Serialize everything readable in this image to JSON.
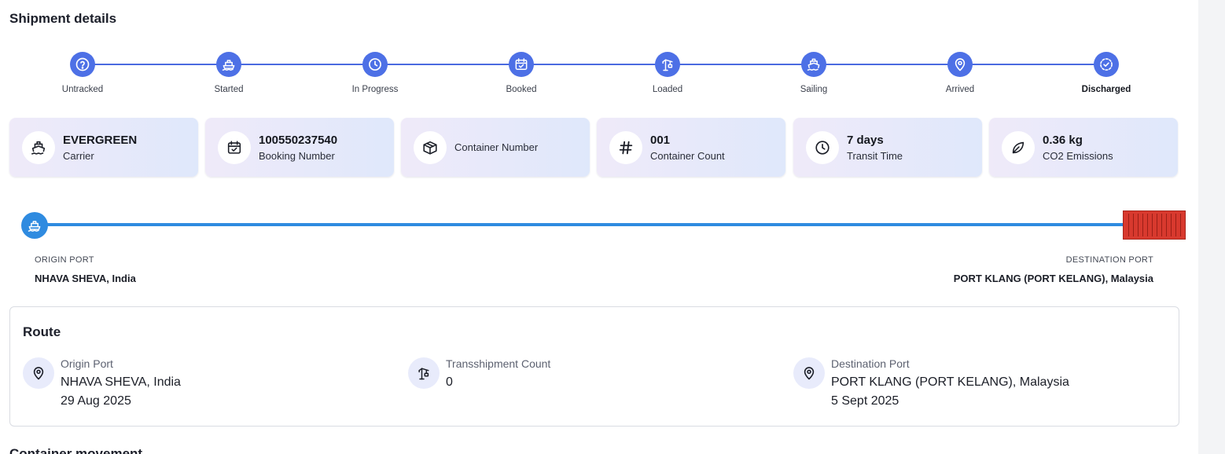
{
  "page": {
    "title": "Shipment details",
    "next_section_title": "Container movement"
  },
  "stepper": {
    "steps": [
      {
        "label": "Untracked",
        "icon": "help-circle-icon"
      },
      {
        "label": "Started",
        "icon": "ship-icon"
      },
      {
        "label": "In Progress",
        "icon": "clock-icon"
      },
      {
        "label": "Booked",
        "icon": "calendar-check-icon"
      },
      {
        "label": "Loaded",
        "icon": "crane-icon"
      },
      {
        "label": "Sailing",
        "icon": "ship-sailing-icon"
      },
      {
        "label": "Arrived",
        "icon": "map-pin-icon"
      },
      {
        "label": "Discharged",
        "icon": "dashed-check-circle-icon"
      }
    ],
    "current_step": "Discharged"
  },
  "cards": {
    "carrier": {
      "value": "EVERGREEN",
      "label": "Carrier",
      "icon": "ship-icon"
    },
    "booking": {
      "value": "100550237540",
      "label": "Booking Number",
      "icon": "calendar-check-icon"
    },
    "container": {
      "label": "Container Number",
      "icon": "box-icon"
    },
    "count": {
      "value": "001",
      "label": "Container Count",
      "icon": "hash-icon"
    },
    "transit": {
      "value": "7 days",
      "label": "Transit Time",
      "icon": "clock-icon"
    },
    "co2": {
      "value": "0.36 kg",
      "label": "CO2 Emissions",
      "icon": "leaf-icon"
    }
  },
  "progress": {
    "origin_label": "ORIGIN PORT",
    "origin_name": "NHAVA SHEVA, India",
    "destination_label": "DESTINATION PORT",
    "destination_name": "PORT KLANG (PORT KELANG), Malaysia",
    "completion": 1.0
  },
  "route": {
    "title": "Route",
    "origin": {
      "label": "Origin Port",
      "value": "NHAVA SHEVA, India",
      "date": "29 Aug 2025",
      "icon": "map-pin-icon"
    },
    "transshipment": {
      "label": "Transshipment Count",
      "value": "0",
      "icon": "crane-icon"
    },
    "destination": {
      "label": "Destination Port",
      "value": "PORT KLANG (PORT KELANG), Malaysia",
      "date": "5 Sept 2025",
      "icon": "map-pin-icon"
    }
  },
  "colors": {
    "accent": "#4d70e6",
    "track": "#2f8be0",
    "container": "#d8392e"
  }
}
